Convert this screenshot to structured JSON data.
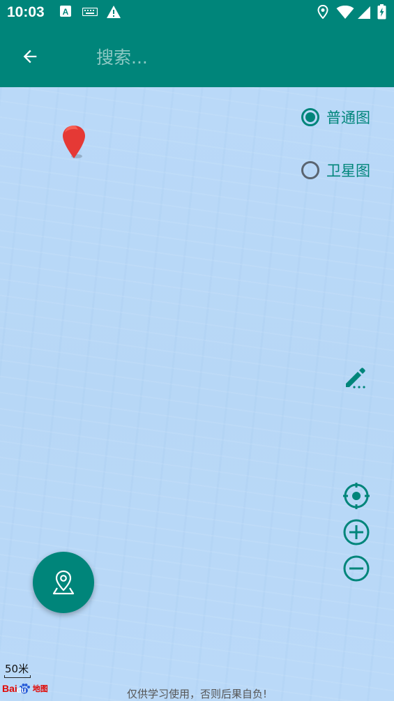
{
  "status_bar": {
    "time": "10:03"
  },
  "app_bar": {
    "search_placeholder": "搜索..."
  },
  "map_type": {
    "options": [
      {
        "label": "普通图",
        "selected": true
      },
      {
        "label": "卫星图",
        "selected": false
      }
    ]
  },
  "map_footer": {
    "scale": "50米",
    "disclaimer": "仅供学习使用，否则后果自负!",
    "logo_bai": "Bai",
    "logo_du": "du",
    "logo_ditu": "地图"
  },
  "colors": {
    "primary": "#00857a",
    "map_water": "#b9d9f7",
    "marker": "#e53935"
  },
  "icons": {
    "back": "arrow-back-icon",
    "edit": "pencil-edit-icon",
    "locate": "my-location-icon",
    "zoom_in": "zoom-in-icon",
    "zoom_out": "zoom-out-icon",
    "fab": "location-pin-icon"
  }
}
